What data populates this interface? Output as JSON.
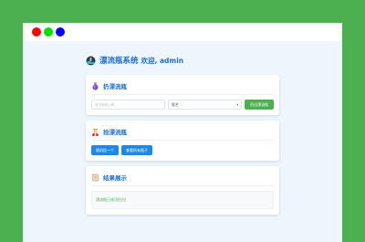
{
  "window": {
    "dots": [
      "red",
      "green",
      "blue"
    ]
  },
  "header": {
    "title": "漂流瓶系统",
    "welcome": "欢迎, admin"
  },
  "throw_card": {
    "title": "扔漂流瓶",
    "input_placeholder": "写下你的心声...",
    "select_value": "匿名",
    "button_label": "扔出漂流瓶"
  },
  "pick_card": {
    "title": "捡漂流瓶",
    "random_button": "随机捡一个",
    "all_button": "查看所有瓶子"
  },
  "result_card": {
    "title": "结果展示",
    "message": "漂流瓶已成功扔出!"
  },
  "colors": {
    "accent": "#1e6fc7",
    "success": "#4caf50",
    "button_blue": "#1e88e5",
    "background": "#4caf50"
  }
}
